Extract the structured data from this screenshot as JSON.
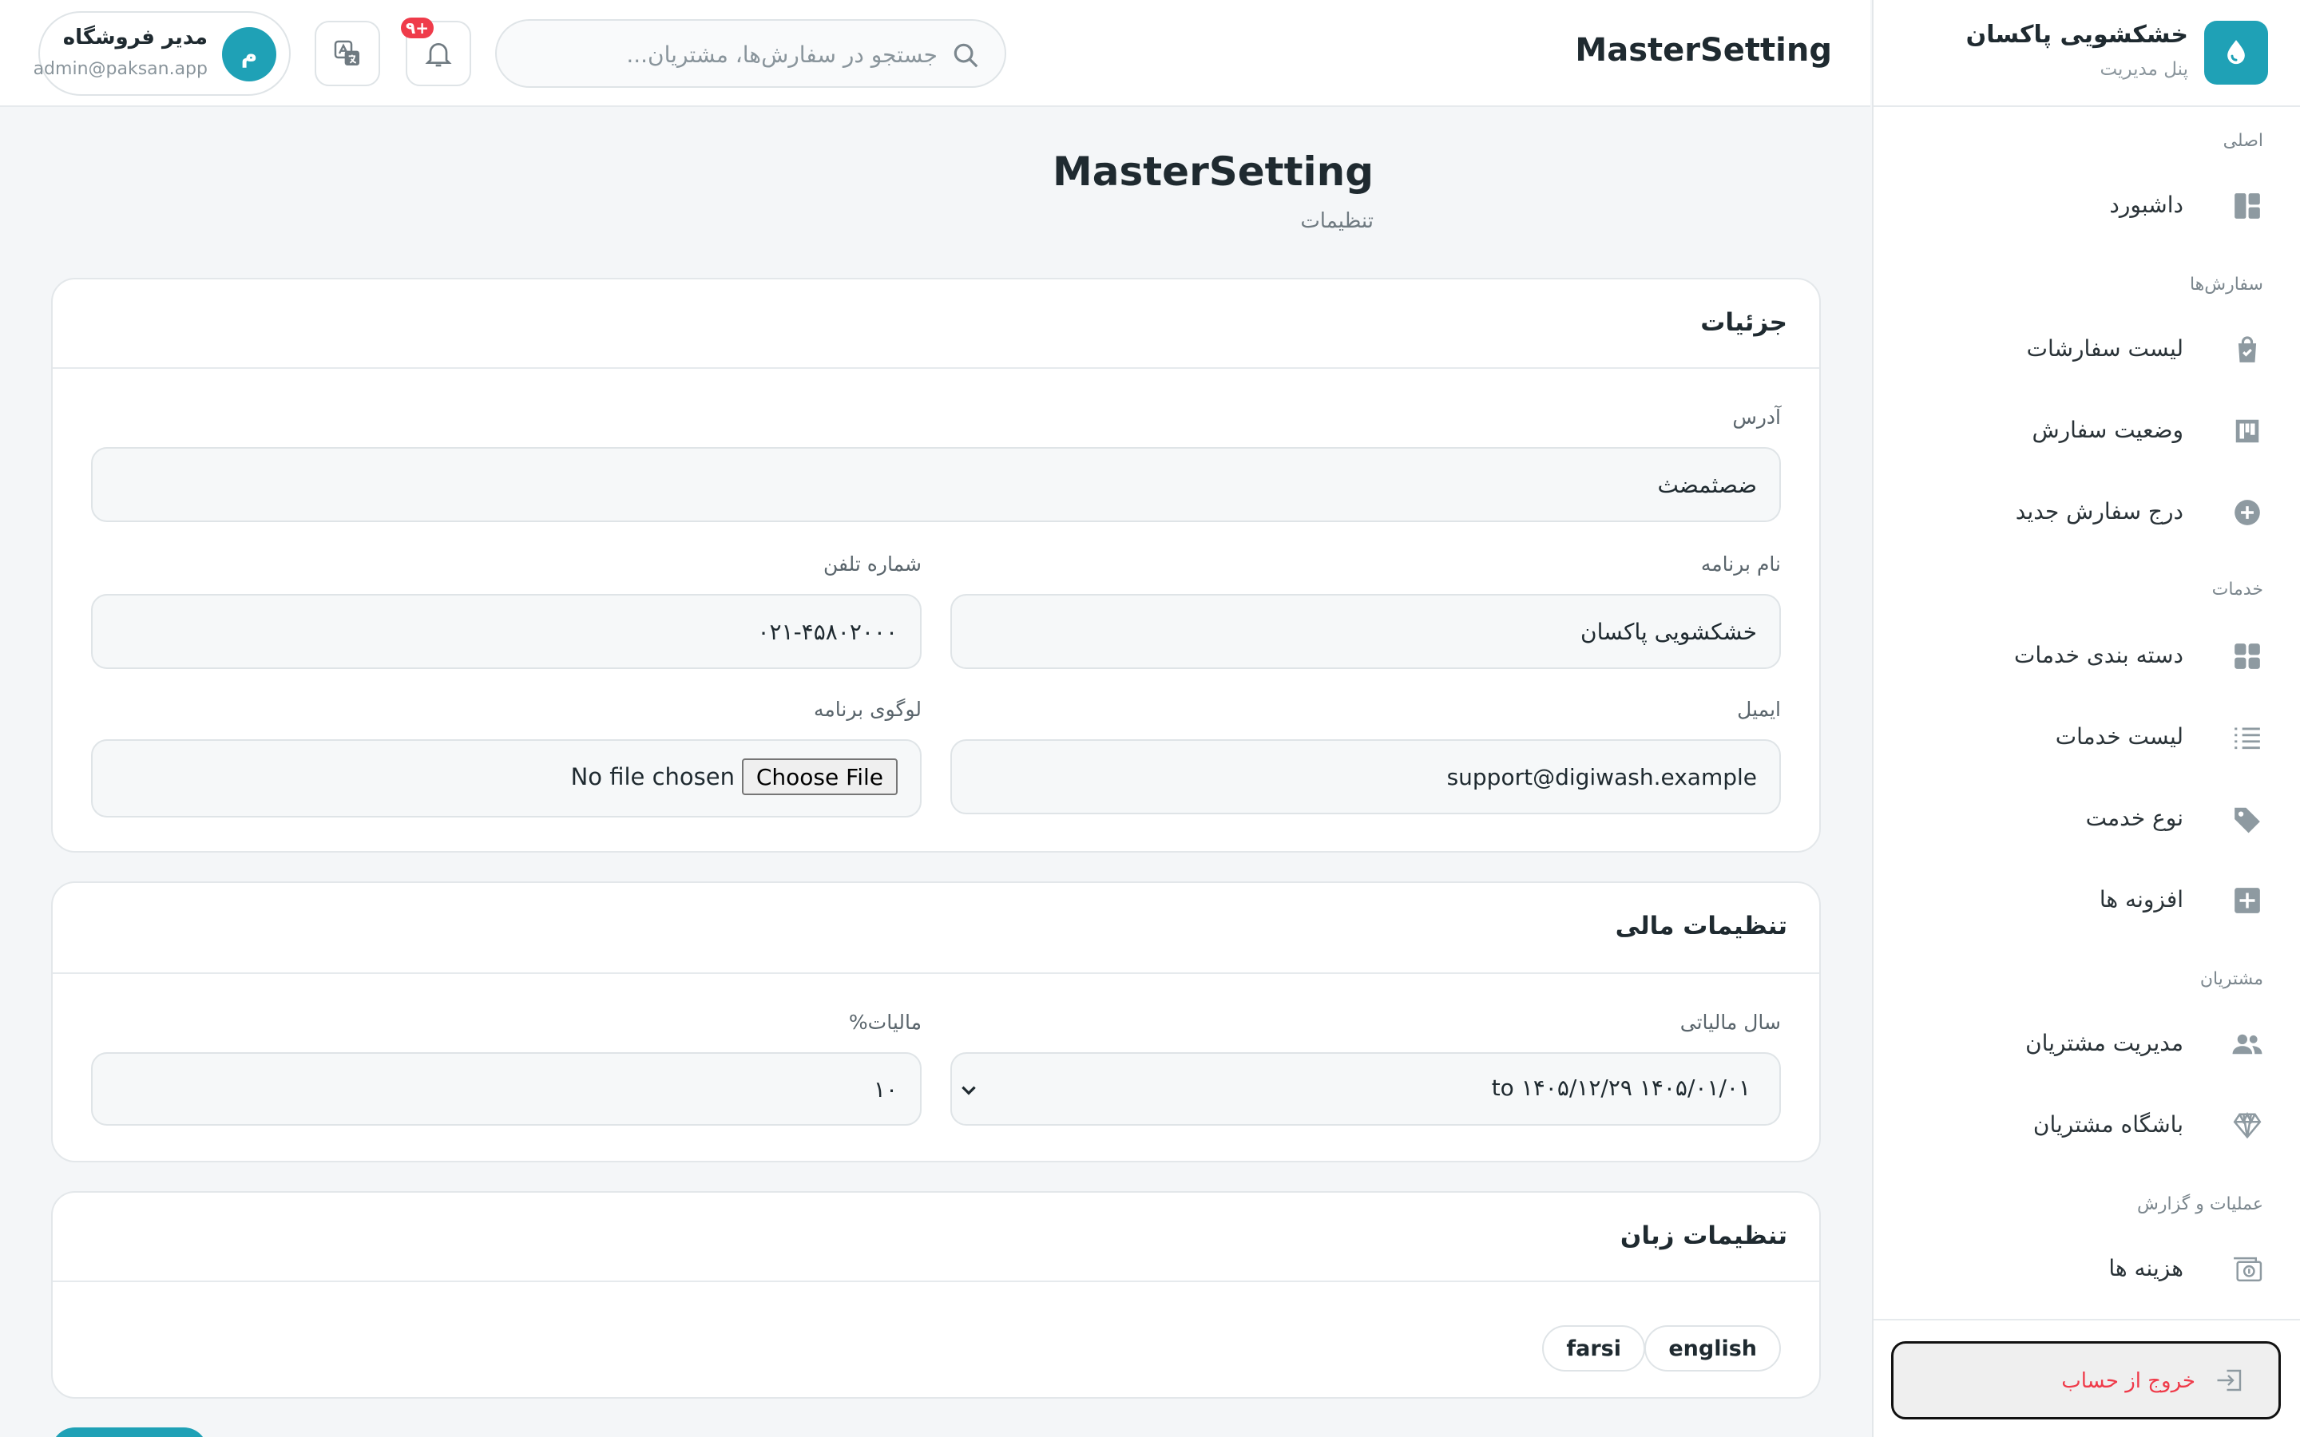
{
  "brand": {
    "title": "خشکشویی پاکسان",
    "subtitle": "پنل مدیریت"
  },
  "sidebar": {
    "sections": [
      {
        "title": "اصلی",
        "items": [
          {
            "label": "داشبورد",
            "icon": "dashboard-icon"
          }
        ]
      },
      {
        "title": "سفارش‌ها",
        "items": [
          {
            "label": "لیست سفارشات",
            "icon": "shopping-bag-icon"
          },
          {
            "label": "وضعیت سفارش",
            "icon": "kanban-icon"
          },
          {
            "label": "درج سفارش جدید",
            "icon": "plus-circle-icon"
          }
        ]
      },
      {
        "title": "خدمات",
        "items": [
          {
            "label": "دسته بندی خدمات",
            "icon": "grid-icon"
          },
          {
            "label": "لیست خدمات",
            "icon": "list-icon"
          },
          {
            "label": "نوع خدمت",
            "icon": "tag-icon"
          },
          {
            "label": "افزونه ها",
            "icon": "plus-square-icon"
          }
        ]
      },
      {
        "title": "مشتریان",
        "items": [
          {
            "label": "مدیریت مشتریان",
            "icon": "users-icon"
          },
          {
            "label": "باشگاه مشتریان",
            "icon": "diamond-icon"
          }
        ]
      },
      {
        "title": "عملیات و گزارش",
        "items": [
          {
            "label": "هزینه ها",
            "icon": "money-icon"
          }
        ]
      }
    ],
    "logout_label": "خروج از حساب"
  },
  "header": {
    "title": "MasterSetting",
    "search_placeholder": "جستجو در سفارش‌ها، مشتریان...",
    "notification_badge": "+۹",
    "user": {
      "initial": "م",
      "name": "مدیر فروشگاه",
      "email": "admin@paksan.app"
    }
  },
  "page": {
    "title": "MasterSetting",
    "subtitle": "تنظیمات"
  },
  "details_card": {
    "title": "جزئیات",
    "address_label": "آدرس",
    "address_value": "ضصثمضث",
    "app_name_label": "نام برنامه",
    "app_name_value": "خشکشویی پاکسان",
    "phone_label": "شماره تلفن",
    "phone_value": "۰۲۱-۴۵۸۰۲۰۰۰",
    "email_label": "ایمیل",
    "email_value": "support@digiwash.example",
    "logo_label": "لوگوی برنامه",
    "file_button": "Choose File",
    "file_status": "No file chosen"
  },
  "finance_card": {
    "title": "تنظیمات مالی",
    "fiscal_year_label": "سال مالیاتی",
    "fiscal_year_value": "۱۴۰۵/۰۱/۰۱ to ۱۴۰۵/۱۲/۲۹",
    "tax_label": "مالیات%",
    "tax_value": "۱۰"
  },
  "language_card": {
    "title": "تنظیمات زبان",
    "languages": [
      "english",
      "farsi"
    ]
  },
  "colors": {
    "accent": "#1fa1b6",
    "danger": "#ef3b4a",
    "text": "#1f2a30",
    "muted": "#8a959c",
    "background": "#f4f6f8"
  }
}
